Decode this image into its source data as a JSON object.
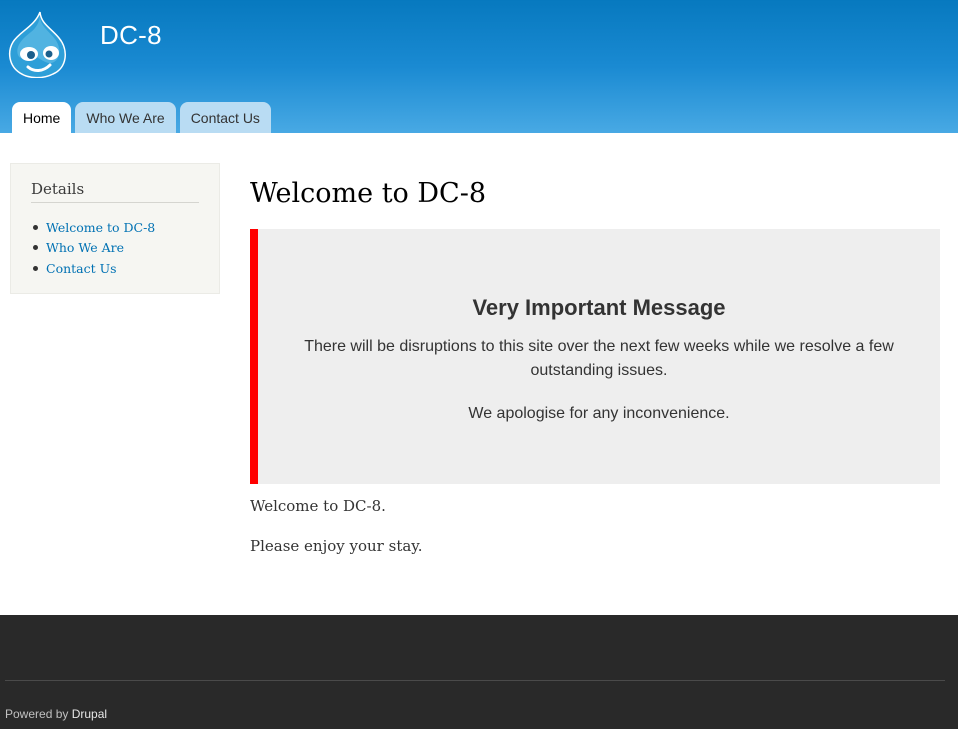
{
  "header": {
    "site_name": "DC-8",
    "tabs": [
      {
        "label": "Home",
        "active": true
      },
      {
        "label": "Who We Are",
        "active": false
      },
      {
        "label": "Contact Us",
        "active": false
      }
    ],
    "logo_icon": "drupal-drop-icon"
  },
  "sidebar": {
    "title": "Details",
    "links": [
      "Welcome to DC-8",
      "Who We Are",
      "Contact Us"
    ]
  },
  "main": {
    "title": "Welcome to DC-8",
    "message": {
      "heading": "Very Important Message",
      "body": "There will be disruptions to this site over the next few weeks while we resolve a few outstanding issues.",
      "apology": "We apologise for any inconvenience."
    },
    "paragraphs": [
      "Welcome to DC-8.",
      "Please enjoy your stay."
    ]
  },
  "footer": {
    "powered_prefix": "Powered by",
    "powered_link": "Drupal"
  },
  "colors": {
    "header_top": "#0779bf",
    "header_bottom": "#48a9e4",
    "link": "#0071b3",
    "message_border": "#ff0000",
    "footer_bg": "#292929"
  }
}
